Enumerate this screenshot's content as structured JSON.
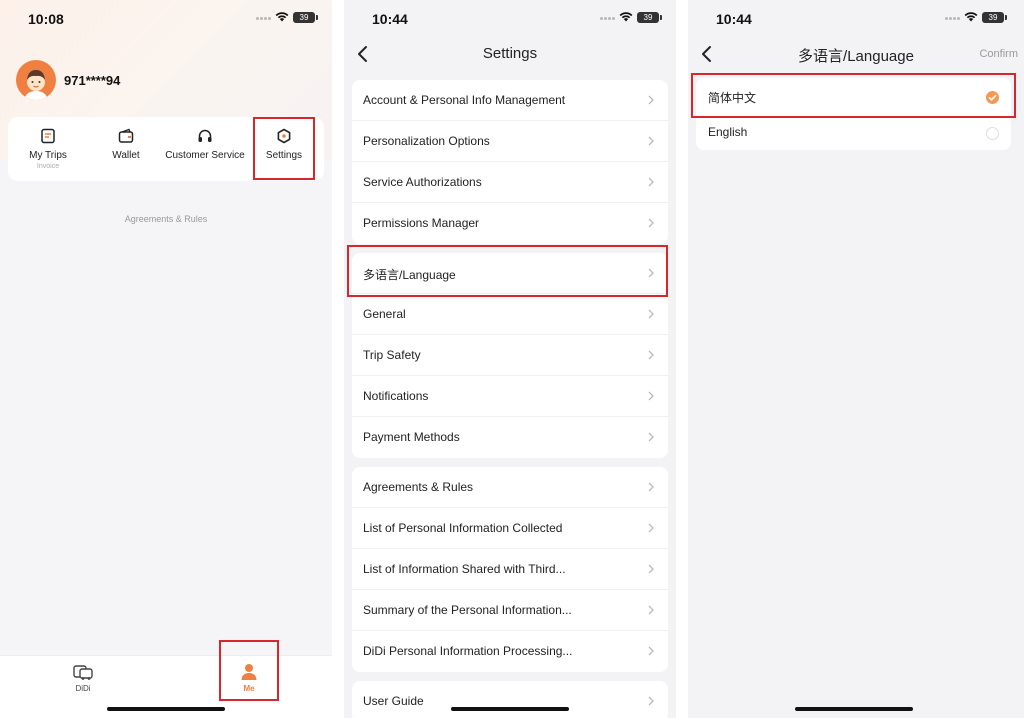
{
  "colors": {
    "accent": "#f07f42",
    "highlight": "#d7262c",
    "check": "#f29a55"
  },
  "screen1": {
    "time": "10:08",
    "battery": "39",
    "username": "971****94",
    "quick_actions": [
      {
        "label": "My Trips",
        "sub": "Invoice",
        "icon": "trips-icon"
      },
      {
        "label": "Wallet",
        "icon": "wallet-icon"
      },
      {
        "label": "Customer Service",
        "icon": "headset-icon"
      },
      {
        "label": "Settings",
        "icon": "gear-icon"
      }
    ],
    "agreements_link": "Agreements & Rules",
    "tabs": [
      {
        "label": "DiDi",
        "icon": "car-icon"
      },
      {
        "label": "Me",
        "icon": "person-icon"
      }
    ]
  },
  "screen2": {
    "time": "10:44",
    "battery": "39",
    "title": "Settings",
    "group1": [
      "Account & Personal Info Management",
      "Personalization Options",
      "Service Authorizations",
      "Permissions Manager"
    ],
    "group2": [
      "多语言/Language",
      "General",
      "Trip Safety",
      "Notifications",
      "Payment Methods"
    ],
    "group3": [
      "Agreements & Rules",
      "List of Personal Information Collected",
      "List of Information Shared with Third...",
      "Summary of the Personal Information...",
      "DiDi Personal Information Processing..."
    ],
    "group4": [
      "User Guide"
    ]
  },
  "screen3": {
    "time": "10:44",
    "battery": "39",
    "title": "多语言/Language",
    "confirm": "Confirm",
    "languages": [
      {
        "label": "简体中文",
        "selected": true
      },
      {
        "label": "English",
        "selected": false
      }
    ]
  }
}
